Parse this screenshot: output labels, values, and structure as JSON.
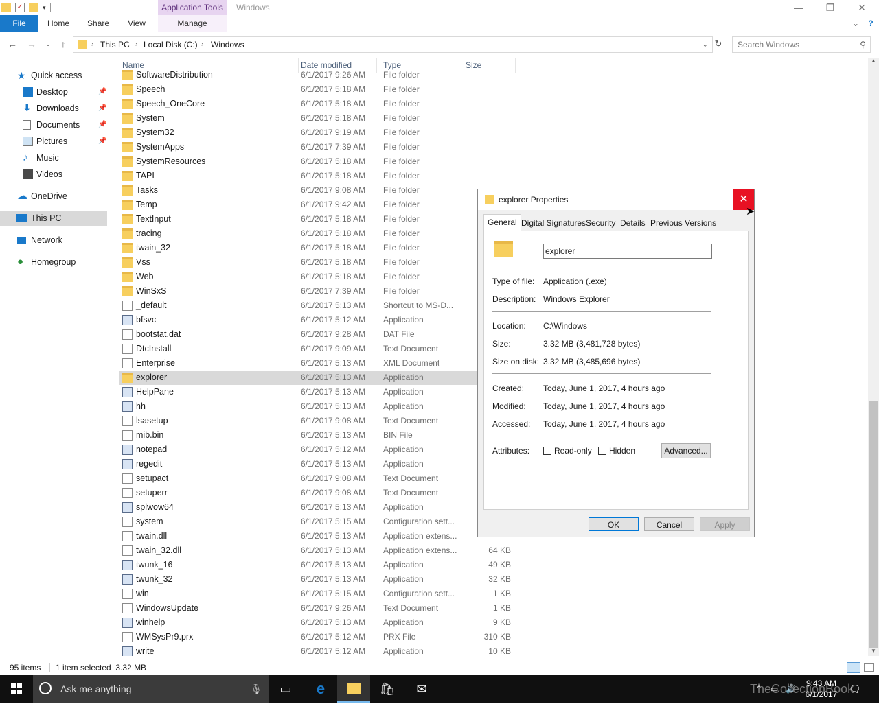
{
  "window": {
    "title": "Windows",
    "context_tab_label": "Application Tools",
    "minimize": "—",
    "maximize": "❐",
    "close": "✕"
  },
  "ribbon": {
    "tabs": [
      "File",
      "Home",
      "Share",
      "View",
      "Manage"
    ],
    "expand": "⌄",
    "help": "?"
  },
  "address": {
    "crumbs": [
      "This PC",
      "Local Disk (C:)",
      "Windows"
    ],
    "search_placeholder": "Search Windows"
  },
  "nav": {
    "quick_access": "Quick access",
    "items": [
      {
        "label": "Desktop",
        "pinned": true
      },
      {
        "label": "Downloads",
        "pinned": true
      },
      {
        "label": "Documents",
        "pinned": true
      },
      {
        "label": "Pictures",
        "pinned": true
      },
      {
        "label": "Music",
        "pinned": false
      },
      {
        "label": "Videos",
        "pinned": false
      }
    ],
    "onedrive": "OneDrive",
    "this_pc": "This PC",
    "network": "Network",
    "homegroup": "Homegroup"
  },
  "columns": {
    "name": "Name",
    "date": "Date modified",
    "type": "Type",
    "size": "Size"
  },
  "files": [
    {
      "name": "SoftwareDistribution",
      "date": "6/1/2017 9:26 AM",
      "type": "File folder",
      "size": "",
      "icon": "folder"
    },
    {
      "name": "Speech",
      "date": "6/1/2017 5:18 AM",
      "type": "File folder",
      "size": "",
      "icon": "folder"
    },
    {
      "name": "Speech_OneCore",
      "date": "6/1/2017 5:18 AM",
      "type": "File folder",
      "size": "",
      "icon": "folder"
    },
    {
      "name": "System",
      "date": "6/1/2017 5:18 AM",
      "type": "File folder",
      "size": "",
      "icon": "folder"
    },
    {
      "name": "System32",
      "date": "6/1/2017 9:19 AM",
      "type": "File folder",
      "size": "",
      "icon": "folder"
    },
    {
      "name": "SystemApps",
      "date": "6/1/2017 7:39 AM",
      "type": "File folder",
      "size": "",
      "icon": "folder"
    },
    {
      "name": "SystemResources",
      "date": "6/1/2017 5:18 AM",
      "type": "File folder",
      "size": "",
      "icon": "folder"
    },
    {
      "name": "TAPI",
      "date": "6/1/2017 5:18 AM",
      "type": "File folder",
      "size": "",
      "icon": "folder"
    },
    {
      "name": "Tasks",
      "date": "6/1/2017 9:08 AM",
      "type": "File folder",
      "size": "",
      "icon": "folder"
    },
    {
      "name": "Temp",
      "date": "6/1/2017 9:42 AM",
      "type": "File folder",
      "size": "",
      "icon": "folder"
    },
    {
      "name": "TextInput",
      "date": "6/1/2017 5:18 AM",
      "type": "File folder",
      "size": "",
      "icon": "folder"
    },
    {
      "name": "tracing",
      "date": "6/1/2017 5:18 AM",
      "type": "File folder",
      "size": "",
      "icon": "folder"
    },
    {
      "name": "twain_32",
      "date": "6/1/2017 5:18 AM",
      "type": "File folder",
      "size": "",
      "icon": "folder"
    },
    {
      "name": "Vss",
      "date": "6/1/2017 5:18 AM",
      "type": "File folder",
      "size": "",
      "icon": "folder"
    },
    {
      "name": "Web",
      "date": "6/1/2017 5:18 AM",
      "type": "File folder",
      "size": "",
      "icon": "folder"
    },
    {
      "name": "WinSxS",
      "date": "6/1/2017 7:39 AM",
      "type": "File folder",
      "size": "",
      "icon": "folder"
    },
    {
      "name": "_default",
      "date": "6/1/2017 5:13 AM",
      "type": "Shortcut to MS-D...",
      "size": "",
      "icon": "doc"
    },
    {
      "name": "bfsvc",
      "date": "6/1/2017 5:12 AM",
      "type": "Application",
      "size": "",
      "icon": "app"
    },
    {
      "name": "bootstat.dat",
      "date": "6/1/2017 9:28 AM",
      "type": "DAT File",
      "size": "",
      "icon": "doc"
    },
    {
      "name": "DtcInstall",
      "date": "6/1/2017 9:09 AM",
      "type": "Text Document",
      "size": "",
      "icon": "doc"
    },
    {
      "name": "Enterprise",
      "date": "6/1/2017 5:13 AM",
      "type": "XML Document",
      "size": "",
      "icon": "doc"
    },
    {
      "name": "explorer",
      "date": "6/1/2017 5:13 AM",
      "type": "Application",
      "size": "",
      "icon": "folder",
      "selected": true
    },
    {
      "name": "HelpPane",
      "date": "6/1/2017 5:13 AM",
      "type": "Application",
      "size": "",
      "icon": "app"
    },
    {
      "name": "hh",
      "date": "6/1/2017 5:13 AM",
      "type": "Application",
      "size": "",
      "icon": "app"
    },
    {
      "name": "lsasetup",
      "date": "6/1/2017 9:08 AM",
      "type": "Text Document",
      "size": "",
      "icon": "doc"
    },
    {
      "name": "mib.bin",
      "date": "6/1/2017 5:13 AM",
      "type": "BIN File",
      "size": "",
      "icon": "doc"
    },
    {
      "name": "notepad",
      "date": "6/1/2017 5:12 AM",
      "type": "Application",
      "size": "",
      "icon": "app"
    },
    {
      "name": "regedit",
      "date": "6/1/2017 5:13 AM",
      "type": "Application",
      "size": "",
      "icon": "app"
    },
    {
      "name": "setupact",
      "date": "6/1/2017 9:08 AM",
      "type": "Text Document",
      "size": "",
      "icon": "doc"
    },
    {
      "name": "setuperr",
      "date": "6/1/2017 9:08 AM",
      "type": "Text Document",
      "size": "",
      "icon": "doc"
    },
    {
      "name": "splwow64",
      "date": "6/1/2017 5:13 AM",
      "type": "Application",
      "size": "",
      "icon": "app"
    },
    {
      "name": "system",
      "date": "6/1/2017 5:15 AM",
      "type": "Configuration sett...",
      "size": "",
      "icon": "doc"
    },
    {
      "name": "twain.dll",
      "date": "6/1/2017 5:13 AM",
      "type": "Application extens...",
      "size": "",
      "icon": "doc"
    },
    {
      "name": "twain_32.dll",
      "date": "6/1/2017 5:13 AM",
      "type": "Application extens...",
      "size": "64 KB",
      "icon": "doc"
    },
    {
      "name": "twunk_16",
      "date": "6/1/2017 5:13 AM",
      "type": "Application",
      "size": "49 KB",
      "icon": "app"
    },
    {
      "name": "twunk_32",
      "date": "6/1/2017 5:13 AM",
      "type": "Application",
      "size": "32 KB",
      "icon": "app"
    },
    {
      "name": "win",
      "date": "6/1/2017 5:15 AM",
      "type": "Configuration sett...",
      "size": "1 KB",
      "icon": "doc"
    },
    {
      "name": "WindowsUpdate",
      "date": "6/1/2017 9:26 AM",
      "type": "Text Document",
      "size": "1 KB",
      "icon": "doc"
    },
    {
      "name": "winhelp",
      "date": "6/1/2017 5:13 AM",
      "type": "Application",
      "size": "9 KB",
      "icon": "app"
    },
    {
      "name": "WMSysPr9.prx",
      "date": "6/1/2017 5:12 AM",
      "type": "PRX File",
      "size": "310 KB",
      "icon": "doc"
    },
    {
      "name": "write",
      "date": "6/1/2017 5:12 AM",
      "type": "Application",
      "size": "10 KB",
      "icon": "app"
    }
  ],
  "status": {
    "count": "95 items",
    "selection": "1 item selected  3.32 MB"
  },
  "dialog": {
    "title": "explorer Properties",
    "close": "✕",
    "tabs": [
      "General",
      "Digital Signatures",
      "Security",
      "Details",
      "Previous Versions"
    ],
    "name_value": "explorer",
    "fields": [
      {
        "label": "Type of file:",
        "value": "Application (.exe)"
      },
      {
        "label": "Description:",
        "value": "Windows Explorer"
      },
      {
        "label": "Location:",
        "value": "C:\\Windows"
      },
      {
        "label": "Size:",
        "value": "3.32 MB (3,481,728 bytes)"
      },
      {
        "label": "Size on disk:",
        "value": "3.32 MB (3,485,696 bytes)"
      },
      {
        "label": "Created:",
        "value": "Today, June 1, 2017, 4 hours ago"
      },
      {
        "label": "Modified:",
        "value": "Today, June 1, 2017, 4 hours ago"
      },
      {
        "label": "Accessed:",
        "value": "Today, June 1, 2017, 4 hours ago"
      }
    ],
    "attributes_label": "Attributes:",
    "readonly_label": "Read-only",
    "hidden_label": "Hidden",
    "advanced_label": "Advanced...",
    "ok_label": "OK",
    "cancel_label": "Cancel",
    "apply_label": "Apply"
  },
  "taskbar": {
    "search_placeholder": "Ask me anything",
    "time": "9:43 AM",
    "date": "6/1/2017",
    "watermark": "TheCollectionBook"
  }
}
